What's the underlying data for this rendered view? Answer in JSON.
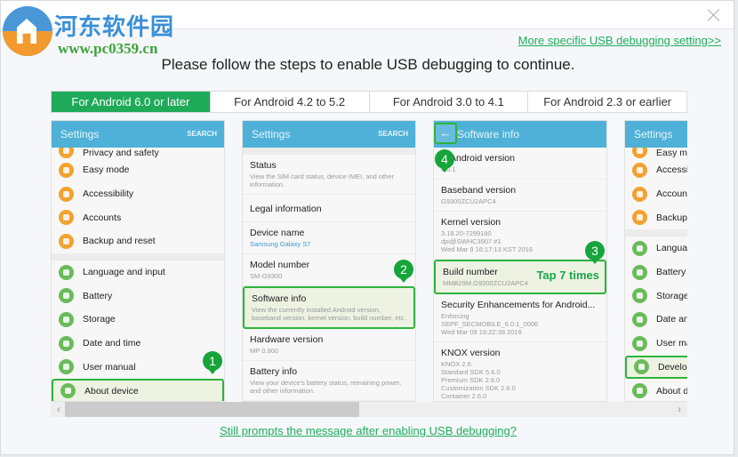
{
  "watermark": {
    "title": "河东软件园",
    "url": "www.pc0359.cn"
  },
  "header": {
    "more_link": "More specific USB debugging setting>>",
    "instruction": "Please follow the steps to enable USB debugging to continue."
  },
  "tabs": [
    {
      "label": "For Android 6.0 or later",
      "active": true
    },
    {
      "label": "For Android 4.2 to 5.2",
      "active": false
    },
    {
      "label": "For Android 3.0 to 4.1",
      "active": false
    },
    {
      "label": "For Android 2.3 or earlier",
      "active": false
    }
  ],
  "colors": {
    "accent": "#1faa5a",
    "phone_header": "#4fb1d8",
    "highlight_border": "#2db43c"
  },
  "phones": {
    "p1": {
      "title": "Settings",
      "search": "SEARCH",
      "partial_top": "Privacy and safety",
      "items_orange": [
        "Easy mode",
        "Accessibility",
        "Accounts",
        "Backup and reset"
      ],
      "items_green": [
        "Language and input",
        "Battery",
        "Storage",
        "Date and time",
        "User manual"
      ],
      "highlighted": "About device",
      "step": "1"
    },
    "p2": {
      "title": "Settings",
      "search": "SEARCH",
      "items": [
        {
          "title": "Status",
          "sub": "View the SIM card status, device IMEI, and other information."
        },
        {
          "title": "Legal information",
          "sub": ""
        },
        {
          "title": "Device name",
          "sub": "Samsung Galaxy S7"
        },
        {
          "title": "Model number",
          "sub": "SM-G9300"
        },
        {
          "title": "Software info",
          "sub": "View the currently installed Android version, baseband version, kernel version, build number, etc."
        },
        {
          "title": "Hardware version",
          "sub": "MP 0.900"
        },
        {
          "title": "Battery info",
          "sub": "View your device's battery status, remaining power, and other information."
        }
      ],
      "step": "2"
    },
    "p3": {
      "title": "Software info",
      "back": "←",
      "items": [
        {
          "title": "Android version",
          "sub": "6.0.1"
        },
        {
          "title": "Baseband version",
          "sub": "G9300ZCU2APC4"
        },
        {
          "title": "Kernel version",
          "sub": "3.18.20-7299180\ndpi@SWHC3907 #1\nWed Mar 9 16:17:13 KST 2016"
        },
        {
          "title": "Build number",
          "sub": "MMB29M.G9300ZCU2APC4"
        },
        {
          "title": "Security Enhancements for Android...",
          "sub": "Enforcing\nSEPF_SECMOBILE_6.0.1_0006\nWed Mar 09 16:22:38 2016"
        },
        {
          "title": "KNOX version",
          "sub": "KNOX 2.6\nStandard SDK 5.6.0\nPremium SDK 2.6.0\nCustomization SDK 2.6.0\nContainer 2.6.0"
        }
      ],
      "tap_label": "Tap 7 times",
      "step_build": "3",
      "step_back": "4"
    },
    "p4": {
      "title": "Settings",
      "partial_top": "Easy mode",
      "items_orange": [
        "Accessibility",
        "Accounts",
        "Backup and reset"
      ],
      "items_green": [
        "Language and input",
        "Battery",
        "Storage",
        "Date and time",
        "User manual"
      ],
      "highlighted": "Developer options",
      "last": "About device"
    }
  },
  "footer": {
    "prompt_link": "Still prompts the message after enabling USB debugging?"
  },
  "scrollbar": {
    "left": "‹",
    "right": "›",
    "position_fraction": 0.47
  }
}
